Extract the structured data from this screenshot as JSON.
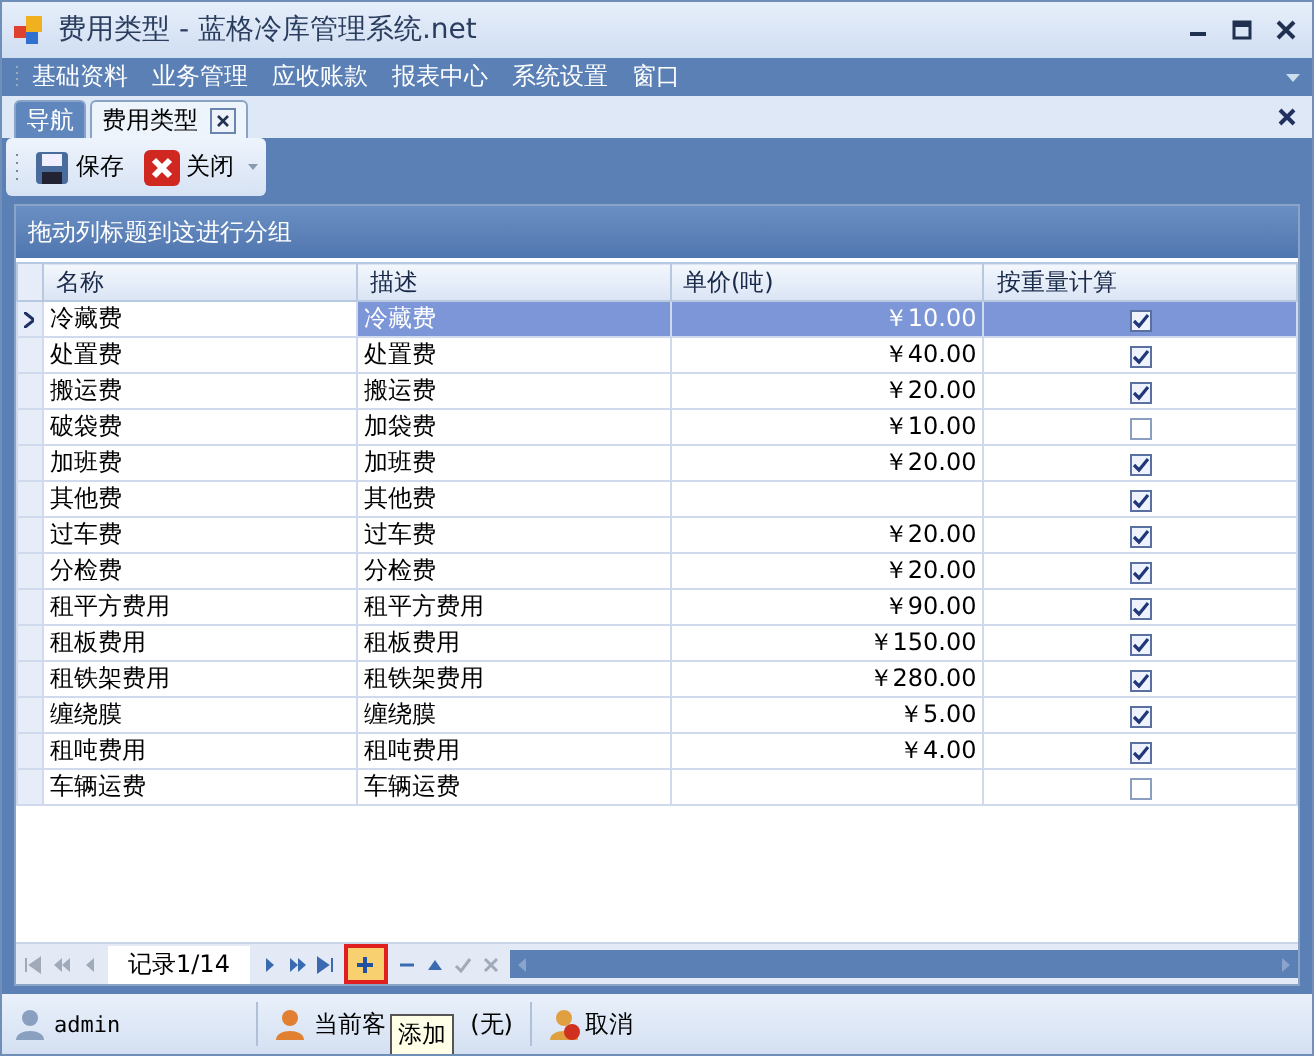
{
  "window": {
    "title": "费用类型 - 蓝格冷库管理系统.net"
  },
  "menu": [
    "基础资料",
    "业务管理",
    "应收账款",
    "报表中心",
    "系统设置",
    "窗口"
  ],
  "tabs": [
    {
      "label": "导航",
      "selected": false,
      "closable": false
    },
    {
      "label": "费用类型",
      "selected": true,
      "closable": true
    }
  ],
  "toolbar": [
    {
      "kind": "save",
      "label": "保存"
    },
    {
      "kind": "close",
      "label": "关闭",
      "dropdown": true
    }
  ],
  "group_panel": {
    "hint": "拖动列标题到这进行分组"
  },
  "table": {
    "columns": [
      "名称",
      "描述",
      "单价(吨)",
      "按重量计算"
    ],
    "rows": [
      {
        "name": "冷藏费",
        "description": "冷藏费",
        "price": "￥10.00",
        "by_weight": true,
        "selected": true
      },
      {
        "name": "处置费",
        "description": "处置费",
        "price": "￥40.00",
        "by_weight": true,
        "selected": false
      },
      {
        "name": "搬运费",
        "description": "搬运费",
        "price": "￥20.00",
        "by_weight": true,
        "selected": false
      },
      {
        "name": "破袋费",
        "description": "加袋费",
        "price": "￥10.00",
        "by_weight": false,
        "selected": false
      },
      {
        "name": "加班费",
        "description": "加班费",
        "price": "￥20.00",
        "by_weight": true,
        "selected": false
      },
      {
        "name": "其他费",
        "description": "其他费",
        "by_weight": true,
        "selected": false
      },
      {
        "name": "过车费",
        "description": "过车费",
        "price": "￥20.00",
        "by_weight": true,
        "selected": false
      },
      {
        "name": "分检费",
        "description": "分检费",
        "price": "￥20.00",
        "by_weight": true,
        "selected": false
      },
      {
        "name": "租平方费用",
        "description": "租平方费用",
        "price": "￥90.00",
        "by_weight": true,
        "selected": false
      },
      {
        "name": "租板费用",
        "description": "租板费用",
        "price": "￥150.00",
        "by_weight": true,
        "selected": false
      },
      {
        "name": "租铁架费用",
        "description": "租铁架费用",
        "price": "￥280.00",
        "by_weight": true,
        "selected": false
      },
      {
        "name": "缠绕膜",
        "description": "缠绕膜",
        "price": "￥5.00",
        "by_weight": true,
        "selected": false
      },
      {
        "name": "租吨费用",
        "description": "租吨费用",
        "price": "￥4.00",
        "by_weight": true,
        "selected": false
      },
      {
        "name": "车辆运费",
        "description": "车辆运费",
        "by_weight": false,
        "selected": false
      }
    ]
  },
  "navigator": {
    "record": "记录1/14",
    "buttons_before": [
      {
        "kind": "first"
      },
      {
        "kind": "prev-page"
      },
      {
        "kind": "prev"
      }
    ],
    "buttons_after": [
      {
        "kind": "next",
        "highlighted": false
      },
      {
        "kind": "next-page",
        "highlighted": false
      },
      {
        "kind": "last",
        "highlighted": false
      },
      {
        "kind": "add",
        "highlighted": true
      },
      {
        "kind": "remove",
        "highlighted": false
      },
      {
        "kind": "up",
        "highlighted": false
      },
      {
        "kind": "check",
        "highlighted": false
      },
      {
        "kind": "cancel",
        "highlighted": false
      }
    ],
    "tooltip": "添加"
  },
  "status_bar": {
    "user": "admin",
    "customer_label": "当前客",
    "customer": "(无)",
    "cancel": "取消"
  }
}
